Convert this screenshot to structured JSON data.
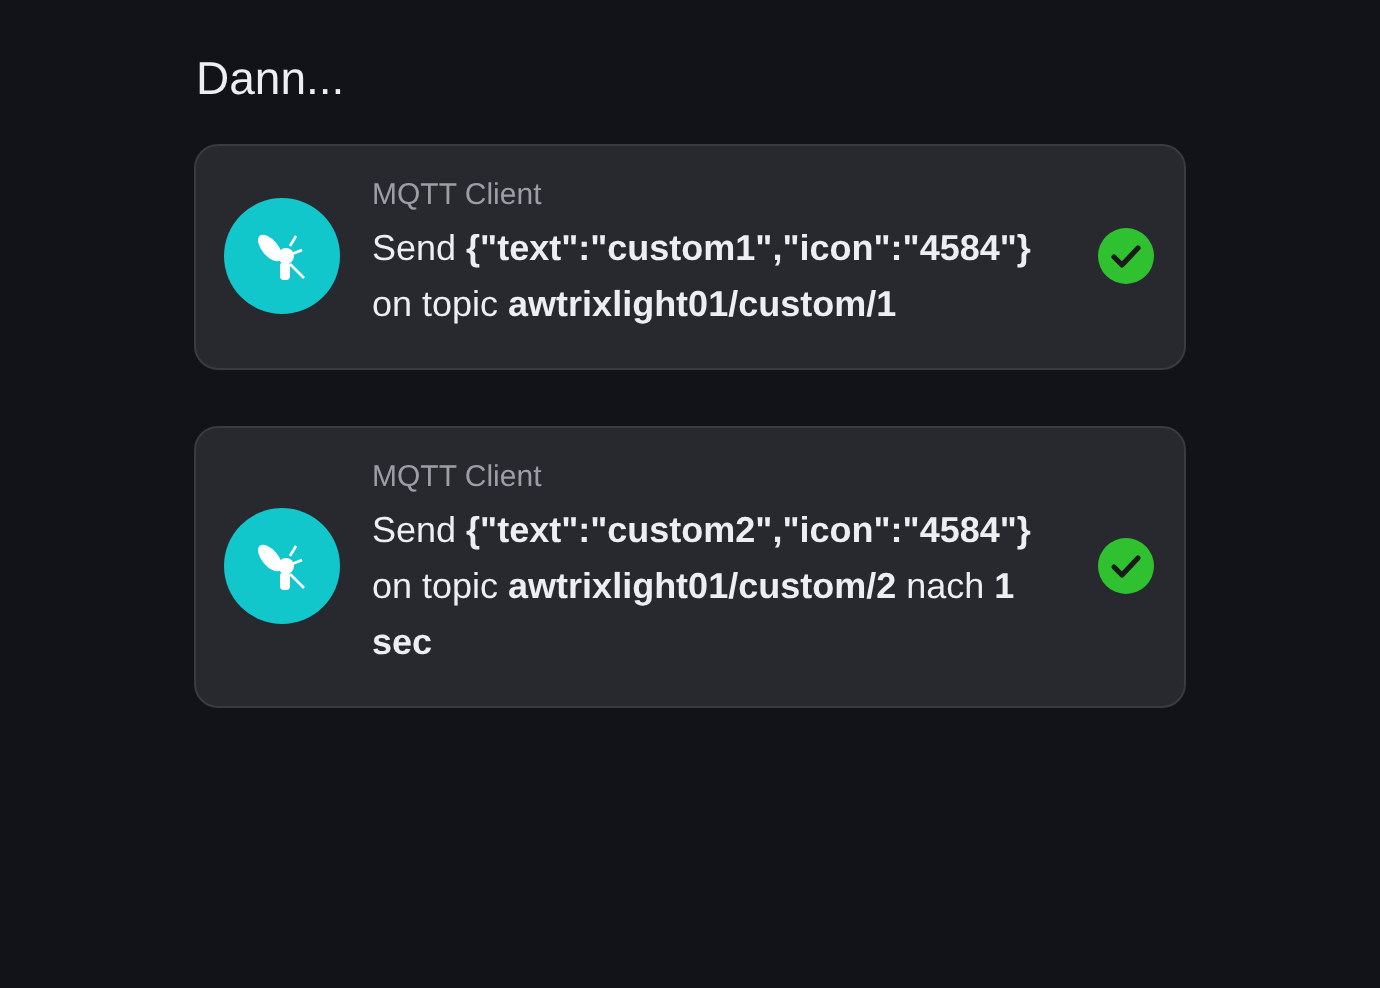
{
  "heading": "Dann...",
  "steps": [
    {
      "source": "MQTT Client",
      "description": "Send **{\"text\":\"custom1\",\"icon\":\"4584\"}** on topic **awtrixlight01/custom/1**",
      "succeeded": true
    },
    {
      "source": "MQTT Client",
      "description": "Send **{\"text\":\"custom2\",\"icon\":\"4584\"}** on topic **awtrixlight01/custom/2** nach **1 sec**",
      "succeeded": true
    }
  ]
}
